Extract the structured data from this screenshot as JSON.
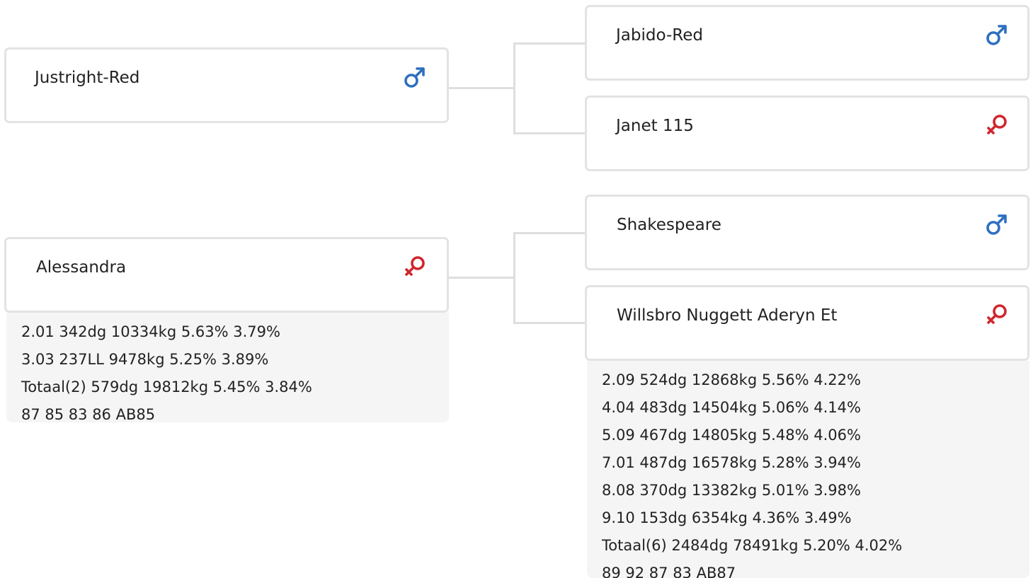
{
  "pedigree": {
    "sire": {
      "name": "Justright-Red",
      "sex_icon": "male-icon",
      "sire": {
        "name": "Jabido-Red",
        "sex_icon": "male-icon"
      },
      "dam": {
        "name": "Janet 115",
        "sex_icon": "female-icon"
      }
    },
    "dam": {
      "name": "Alessandra",
      "sex_icon": "female-icon",
      "stats": [
        "2.01 342dg 10334kg 5.63% 3.79%",
        "3.03 237LL 9478kg 5.25% 3.89%",
        "Totaal(2) 579dg 19812kg 5.45% 3.84%",
        "87 85 83 86 AB85"
      ],
      "sire": {
        "name": "Shakespeare",
        "sex_icon": "male-icon"
      },
      "dam": {
        "name": "Willsbro Nuggett Aderyn Et",
        "sex_icon": "female-icon",
        "stats": [
          "2.09 524dg 12868kg 5.56% 4.22%",
          "4.04 483dg 14504kg 5.06% 4.14%",
          "5.09 467dg 14805kg 5.48% 4.06%",
          "7.01 487dg 16578kg 5.28% 3.94%",
          "8.08 370dg 13382kg 5.01% 3.98%",
          "9.10 153dg 6354kg 4.36% 3.49%",
          "Totaal(6) 2484dg 78491kg 5.20% 4.02%",
          "89 92 87 83 AB87"
        ]
      }
    }
  },
  "colors": {
    "male": "#2e6fc0",
    "female": "#d0262e",
    "card_border": "#e3e3e3",
    "connector": "#dedede",
    "stats_bg": "#f5f5f5"
  }
}
